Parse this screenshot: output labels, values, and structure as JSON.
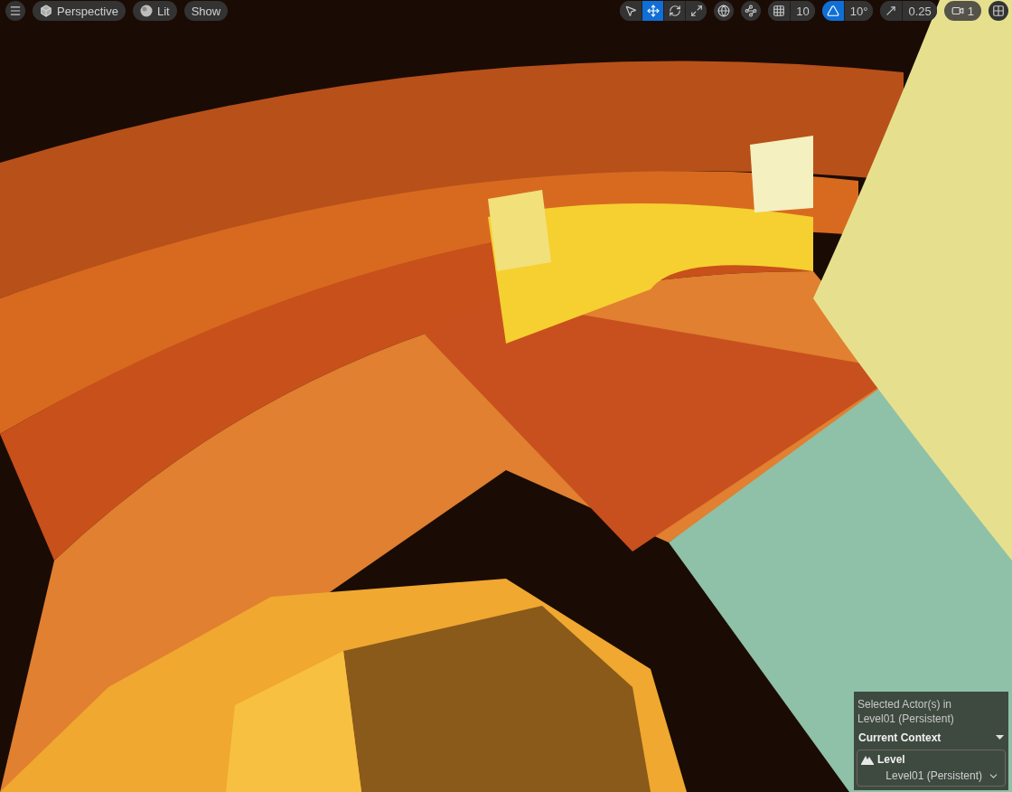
{
  "toolbar_left": [
    {
      "kind": "menu"
    },
    {
      "kind": "view",
      "label": "Perspective"
    },
    {
      "kind": "lighting",
      "label": "Lit"
    },
    {
      "kind": "show",
      "label": "Show"
    }
  ],
  "transform_tools": [
    {
      "kind": "select",
      "selected": false
    },
    {
      "kind": "move",
      "selected": true
    },
    {
      "kind": "rotate",
      "selected": false
    },
    {
      "kind": "scale",
      "selected": false
    }
  ],
  "snap_controls": [
    {
      "kind": "grid",
      "value": "10",
      "on": false
    },
    {
      "kind": "angle",
      "value": "10°",
      "on": true
    },
    {
      "kind": "scale",
      "value": "0.25",
      "on": false
    }
  ],
  "camera_speed": {
    "value": "1"
  },
  "selection_panel": {
    "info": "Selected Actor(s) in Level01 (Persistent)",
    "context_title": "Current Context",
    "expanded": true,
    "item_label": "Level",
    "item_value": "Level01 (Persistent)"
  }
}
